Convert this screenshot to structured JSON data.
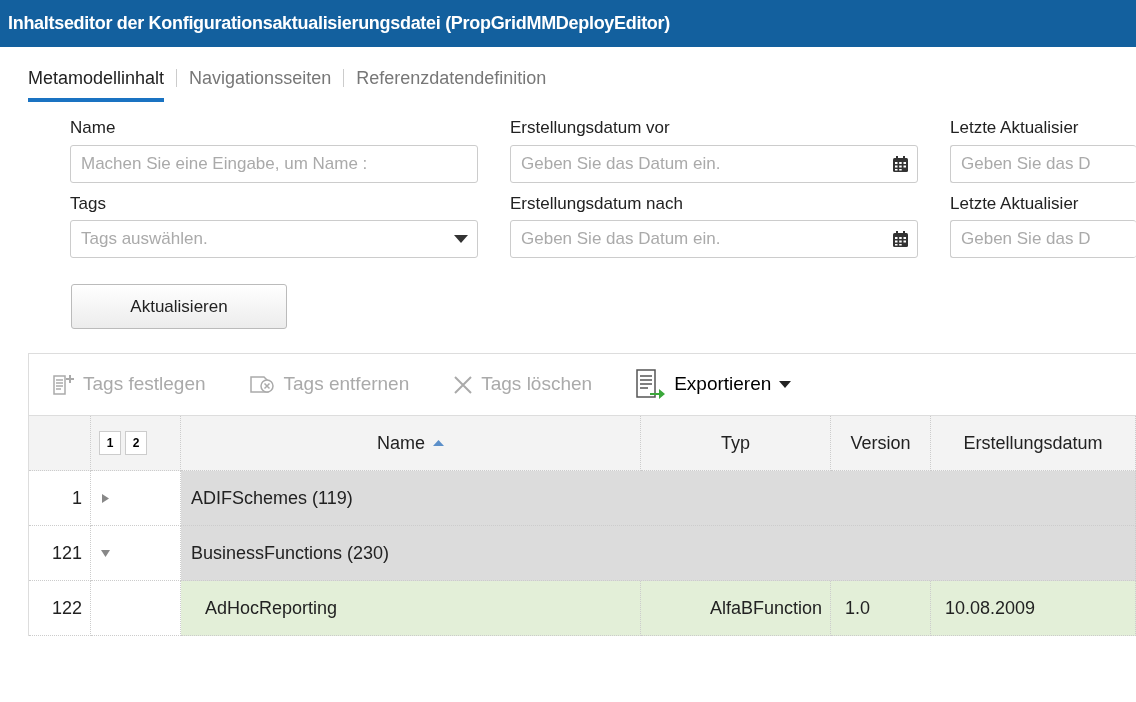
{
  "window": {
    "title": "Inhaltseditor der Konfigurationsaktualisierungsdatei (PropGridMMDeployEditor)"
  },
  "tabs": [
    {
      "label": "Metamodellinhalt",
      "selected": true
    },
    {
      "label": "Navigationsseiten",
      "selected": false
    },
    {
      "label": "Referenzdatendefinition",
      "selected": false
    }
  ],
  "filters": [
    {
      "label": "Name",
      "placeholder": "Machen Sie eine Eingabe, um Name :",
      "kind": "text"
    },
    {
      "label": "Erstellungsdatum vor",
      "placeholder": "Geben Sie das Datum ein.",
      "kind": "date"
    },
    {
      "label": "Letzte Aktualisier",
      "placeholder": "Geben Sie das D",
      "kind": "cut"
    },
    {
      "label": "Tags",
      "placeholder": "Tags auswählen.",
      "kind": "select"
    },
    {
      "label": "Erstellungsdatum nach",
      "placeholder": "Geben Sie das Datum ein.",
      "kind": "date"
    },
    {
      "label": "Letzte Aktualisier",
      "placeholder": "Geben Sie das D",
      "kind": "cut"
    }
  ],
  "refresh_button": "Aktualisieren",
  "toolbar": [
    {
      "label": "Tags festlegen",
      "kind": "add-tag",
      "disabled": true
    },
    {
      "label": "Tags entfernen",
      "kind": "remove-tag",
      "disabled": true
    },
    {
      "label": "Tags löschen",
      "kind": "delete",
      "disabled": true
    },
    {
      "label": "Exportieren",
      "kind": "export",
      "disabled": false
    }
  ],
  "grid": {
    "level_buttons": [
      "1",
      "2"
    ],
    "columns": [
      {
        "label": "Name",
        "sorted": true
      },
      {
        "label": "Typ"
      },
      {
        "label": "Version"
      },
      {
        "label": "Erstellungsdatum"
      }
    ],
    "rows": [
      {
        "number": "1",
        "kind": "group",
        "expanded": false,
        "cells": [
          "ADIFSchemes (119)"
        ]
      },
      {
        "number": "121",
        "kind": "group",
        "expanded": true,
        "cells": [
          "BusinessFunctions (230)"
        ]
      },
      {
        "number": "122",
        "kind": "item",
        "cells": [
          "AdHocReporting",
          "AlfaBFunction",
          "1.0",
          "10.08.2009"
        ]
      }
    ]
  }
}
